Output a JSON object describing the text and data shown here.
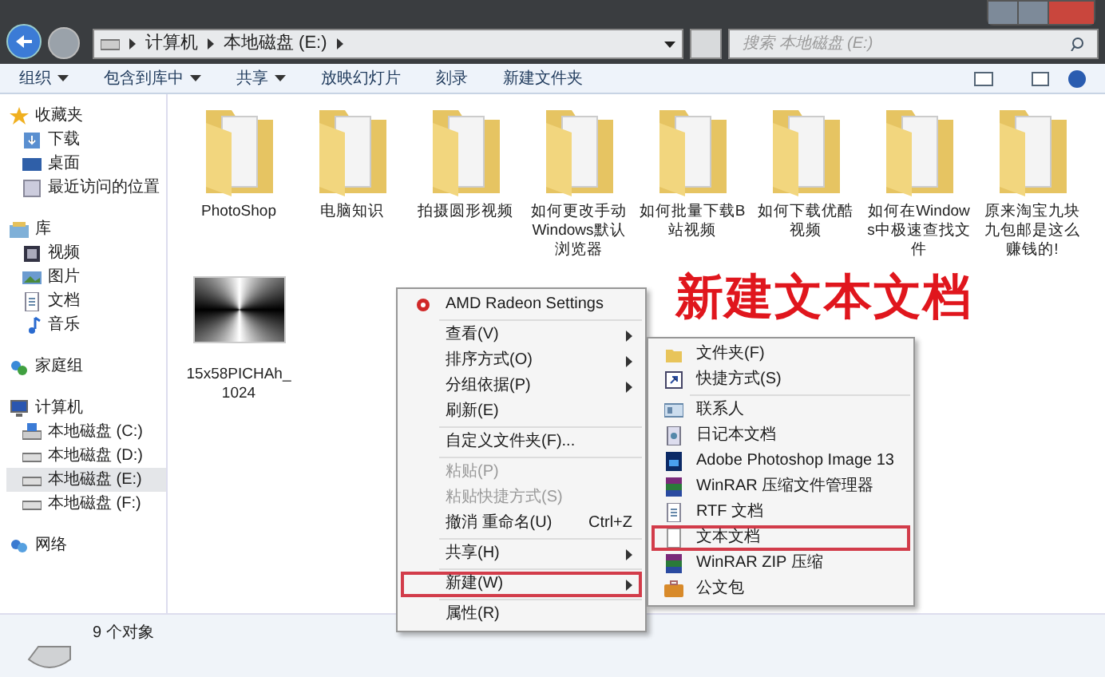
{
  "address_bar": {
    "crumbs": [
      "计算机",
      "本地磁盘 (E:)"
    ]
  },
  "search": {
    "placeholder": "搜索 本地磁盘 (E:)"
  },
  "toolbar": [
    {
      "label": "组织",
      "dropdown": true
    },
    {
      "label": "包含到库中",
      "dropdown": true
    },
    {
      "label": "共享",
      "dropdown": true
    },
    {
      "label": "放映幻灯片",
      "dropdown": false
    },
    {
      "label": "刻录",
      "dropdown": false
    },
    {
      "label": "新建文件夹",
      "dropdown": false
    }
  ],
  "sidebar": [
    {
      "label": "收藏夹",
      "selected": false,
      "children": [
        {
          "label": "下载",
          "selected": false
        },
        {
          "label": "桌面",
          "selected": false
        },
        {
          "label": "最近访问的位置",
          "selected": false
        }
      ]
    },
    {
      "label": "库",
      "selected": false,
      "children": [
        {
          "label": "视频",
          "selected": false
        },
        {
          "label": "图片",
          "selected": false
        },
        {
          "label": "文档",
          "selected": false
        },
        {
          "label": "音乐",
          "selected": false
        }
      ]
    },
    {
      "label": "家庭组",
      "selected": false
    },
    {
      "label": "计算机",
      "selected": false,
      "children": [
        {
          "label": "本地磁盘 (C:)",
          "selected": false
        },
        {
          "label": "本地磁盘 (D:)",
          "selected": false
        },
        {
          "label": "本地磁盘 (E:)",
          "selected": true
        },
        {
          "label": "本地磁盘 (F:)",
          "selected": false
        }
      ]
    },
    {
      "label": "网络",
      "selected": false
    }
  ],
  "files": [
    {
      "name": "PhotoShop",
      "kind": "folder"
    },
    {
      "name": "电脑知识",
      "kind": "folder"
    },
    {
      "name": "拍摄圆形视频",
      "kind": "folder"
    },
    {
      "name": "如何更改手动Windows默认浏览器",
      "kind": "folder"
    },
    {
      "name": "如何批量下载B站视频",
      "kind": "folder"
    },
    {
      "name": "如何下载优酷视频",
      "kind": "folder"
    },
    {
      "name": "如何在Windows中极速查找文件",
      "kind": "folder"
    },
    {
      "name": "原来淘宝九块九包邮是这么赚钱的!",
      "kind": "folder"
    },
    {
      "name": "15x58PICHAh_1024",
      "kind": "image"
    }
  ],
  "annotation": "新建文本文档",
  "context_menu": [
    {
      "kind": "item",
      "label": "AMD Radeon Settings",
      "submenu": false,
      "disabled": false,
      "highlighted": false
    },
    {
      "kind": "separator"
    },
    {
      "kind": "item",
      "label": "查看(V)",
      "submenu": true,
      "disabled": false,
      "highlighted": false
    },
    {
      "kind": "item",
      "label": "排序方式(O)",
      "submenu": true,
      "disabled": false,
      "highlighted": false
    },
    {
      "kind": "item",
      "label": "分组依据(P)",
      "submenu": true,
      "disabled": false,
      "highlighted": false
    },
    {
      "kind": "item",
      "label": "刷新(E)",
      "submenu": false,
      "disabled": false,
      "highlighted": false
    },
    {
      "kind": "separator"
    },
    {
      "kind": "item",
      "label": "自定义文件夹(F)...",
      "submenu": false,
      "disabled": false,
      "highlighted": false
    },
    {
      "kind": "separator"
    },
    {
      "kind": "item",
      "label": "粘贴(P)",
      "submenu": false,
      "disabled": true,
      "highlighted": false
    },
    {
      "kind": "item",
      "label": "粘贴快捷方式(S)",
      "submenu": false,
      "disabled": true,
      "highlighted": false
    },
    {
      "kind": "item",
      "label": "撤消 重命名(U)",
      "shortcut": "Ctrl+Z",
      "submenu": false,
      "disabled": false,
      "highlighted": false
    },
    {
      "kind": "separator"
    },
    {
      "kind": "item",
      "label": "共享(H)",
      "submenu": true,
      "disabled": false,
      "highlighted": false
    },
    {
      "kind": "separator"
    },
    {
      "kind": "item",
      "label": "新建(W)",
      "submenu": true,
      "disabled": false,
      "highlighted": true
    },
    {
      "kind": "separator"
    },
    {
      "kind": "item",
      "label": "属性(R)",
      "submenu": false,
      "disabled": false,
      "highlighted": false
    }
  ],
  "submenu": [
    {
      "kind": "item",
      "label": "文件夹(F)",
      "highlighted": false
    },
    {
      "kind": "item",
      "label": "快捷方式(S)",
      "highlighted": false
    },
    {
      "kind": "separator"
    },
    {
      "kind": "item",
      "label": "联系人",
      "highlighted": false
    },
    {
      "kind": "item",
      "label": "日记本文档",
      "highlighted": false
    },
    {
      "kind": "item",
      "label": "Adobe Photoshop Image 13",
      "highlighted": false
    },
    {
      "kind": "item",
      "label": "WinRAR 压缩文件管理器",
      "highlighted": false
    },
    {
      "kind": "item",
      "label": "RTF 文档",
      "highlighted": false
    },
    {
      "kind": "item",
      "label": "文本文档",
      "highlighted": true
    },
    {
      "kind": "item",
      "label": "WinRAR ZIP 压缩",
      "highlighted": false
    },
    {
      "kind": "item",
      "label": "公文包",
      "highlighted": false
    }
  ],
  "status_bar": {
    "text": "9 个对象"
  }
}
